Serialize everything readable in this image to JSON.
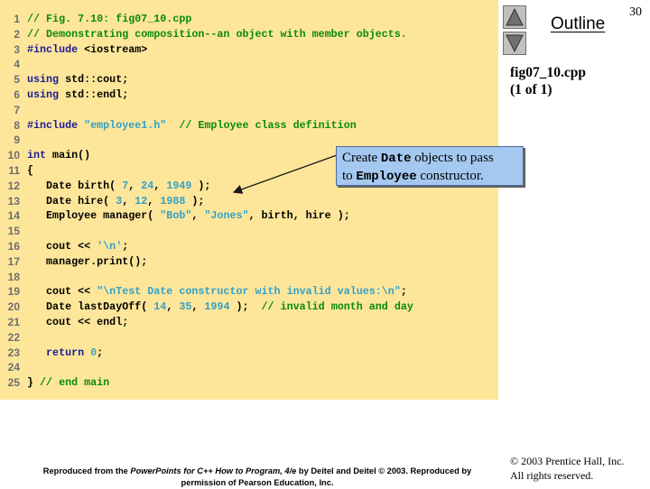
{
  "slide": {
    "page_number": "30",
    "outline_label": "Outline",
    "file_name": "fig07_10.cpp",
    "file_part": "(1 of 1)"
  },
  "navigation": {
    "up_icon": "triangle-up-icon",
    "down_icon": "triangle-down-icon"
  },
  "code": {
    "lines": [
      {
        "n": "1",
        "tokens": [
          {
            "t": "comment",
            "v": "// Fig. 7.10: fig07_10.cpp"
          }
        ]
      },
      {
        "n": "2",
        "tokens": [
          {
            "t": "comment",
            "v": "// Demonstrating composition--an object with member objects."
          }
        ]
      },
      {
        "n": "3",
        "tokens": [
          {
            "t": "keyword",
            "v": "#include"
          },
          {
            "t": "plain",
            "v": " <iostream>"
          }
        ]
      },
      {
        "n": "4",
        "tokens": []
      },
      {
        "n": "5",
        "tokens": [
          {
            "t": "keyword",
            "v": "using"
          },
          {
            "t": "plain",
            "v": " std::cout;"
          }
        ]
      },
      {
        "n": "6",
        "tokens": [
          {
            "t": "keyword",
            "v": "using"
          },
          {
            "t": "plain",
            "v": " std::endl;"
          }
        ]
      },
      {
        "n": "7",
        "tokens": []
      },
      {
        "n": "8",
        "tokens": [
          {
            "t": "keyword",
            "v": "#include"
          },
          {
            "t": "plain",
            "v": " "
          },
          {
            "t": "string",
            "v": "\"employee1.h\""
          },
          {
            "t": "plain",
            "v": "  "
          },
          {
            "t": "comment",
            "v": "// Employee class definition"
          }
        ]
      },
      {
        "n": "9",
        "tokens": []
      },
      {
        "n": "10",
        "tokens": [
          {
            "t": "keyword",
            "v": "int"
          },
          {
            "t": "plain",
            "v": " main()"
          }
        ]
      },
      {
        "n": "11",
        "tokens": [
          {
            "t": "plain",
            "v": "{"
          }
        ]
      },
      {
        "n": "12",
        "tokens": [
          {
            "t": "plain",
            "v": "   Date birth( "
          },
          {
            "t": "number",
            "v": "7"
          },
          {
            "t": "plain",
            "v": ", "
          },
          {
            "t": "number",
            "v": "24"
          },
          {
            "t": "plain",
            "v": ", "
          },
          {
            "t": "number",
            "v": "1949"
          },
          {
            "t": "plain",
            "v": " );"
          }
        ]
      },
      {
        "n": "13",
        "tokens": [
          {
            "t": "plain",
            "v": "   Date hire( "
          },
          {
            "t": "number",
            "v": "3"
          },
          {
            "t": "plain",
            "v": ", "
          },
          {
            "t": "number",
            "v": "12"
          },
          {
            "t": "plain",
            "v": ", "
          },
          {
            "t": "number",
            "v": "1988"
          },
          {
            "t": "plain",
            "v": " );"
          }
        ]
      },
      {
        "n": "14",
        "tokens": [
          {
            "t": "plain",
            "v": "   Employee manager( "
          },
          {
            "t": "string",
            "v": "\"Bob\""
          },
          {
            "t": "plain",
            "v": ", "
          },
          {
            "t": "string",
            "v": "\"Jones\""
          },
          {
            "t": "plain",
            "v": ", birth, hire );"
          }
        ]
      },
      {
        "n": "15",
        "tokens": []
      },
      {
        "n": "16",
        "tokens": [
          {
            "t": "plain",
            "v": "   cout << "
          },
          {
            "t": "string",
            "v": "'\\n'"
          },
          {
            "t": "plain",
            "v": ";"
          }
        ]
      },
      {
        "n": "17",
        "tokens": [
          {
            "t": "plain",
            "v": "   manager.print();"
          }
        ]
      },
      {
        "n": "18",
        "tokens": []
      },
      {
        "n": "19",
        "tokens": [
          {
            "t": "plain",
            "v": "   cout << "
          },
          {
            "t": "string",
            "v": "\"\\nTest Date constructor with invalid values:\\n\""
          },
          {
            "t": "plain",
            "v": ";"
          }
        ]
      },
      {
        "n": "20",
        "tokens": [
          {
            "t": "plain",
            "v": "   Date lastDayOff( "
          },
          {
            "t": "number",
            "v": "14"
          },
          {
            "t": "plain",
            "v": ", "
          },
          {
            "t": "number",
            "v": "35"
          },
          {
            "t": "plain",
            "v": ", "
          },
          {
            "t": "number",
            "v": "1994"
          },
          {
            "t": "plain",
            "v": " );  "
          },
          {
            "t": "comment",
            "v": "// invalid month and day"
          }
        ]
      },
      {
        "n": "21",
        "tokens": [
          {
            "t": "plain",
            "v": "   cout << endl;"
          }
        ]
      },
      {
        "n": "22",
        "tokens": []
      },
      {
        "n": "23",
        "tokens": [
          {
            "t": "plain",
            "v": "   "
          },
          {
            "t": "keyword",
            "v": "return"
          },
          {
            "t": "plain",
            "v": " "
          },
          {
            "t": "number",
            "v": "0"
          },
          {
            "t": "plain",
            "v": ";"
          }
        ]
      },
      {
        "n": "24",
        "tokens": []
      },
      {
        "n": "25",
        "tokens": [
          {
            "t": "plain",
            "v": "} "
          },
          {
            "t": "comment",
            "v": "// end main"
          }
        ]
      }
    ]
  },
  "callout": {
    "line1_pre": "Create ",
    "line1_code": "Date",
    "line1_post": " objects to pass",
    "line2_pre": "to ",
    "line2_code": "Employee",
    "line2_post": " constructor."
  },
  "footer": {
    "credit_pre": "Reproduced from the ",
    "credit_italic": "PowerPoints for C++ How to Program, 4/e",
    "credit_post": " by Deitel and Deitel © 2003. Reproduced by",
    "credit_line2": "permission of Pearson Education, Inc.",
    "copyright_line1": "© 2003 Prentice Hall, Inc.",
    "copyright_line2": "All rights reserved."
  },
  "colors": {
    "panel_bg": "#fde69a",
    "comment": "#0a8a0a",
    "keyword": "#1a1a9a",
    "string": "#33a0c8",
    "callout_bg": "#a4c8f0"
  }
}
